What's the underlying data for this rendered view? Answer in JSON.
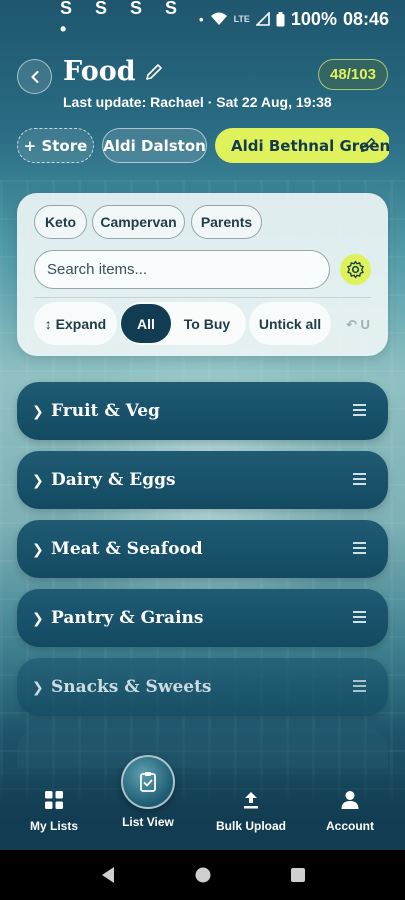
{
  "status_bar": {
    "left_icons": "S S S S •",
    "battery": "100%",
    "time": "08:46",
    "network": "LTE"
  },
  "header": {
    "title": "Food",
    "last_update": "Last update: Rachael · Sat 22 Aug, 19:38",
    "count_badge": "48/103"
  },
  "stores": {
    "add_label": "+ Store",
    "items": [
      "Aldi Dalston",
      "Aldi Bethnal Green"
    ],
    "active": "Aldi Bethnal Green"
  },
  "tags": [
    "Keto",
    "Campervan",
    "Parents"
  ],
  "search": {
    "placeholder": "Search items..."
  },
  "controls": {
    "expand": "↕ Expand",
    "filter_all": "All",
    "filter_to_buy": "To Buy",
    "untick_all": "Untick all",
    "undo": "↶ U"
  },
  "categories": [
    {
      "name": "Fruit & Veg"
    },
    {
      "name": "Dairy & Eggs"
    },
    {
      "name": "Meat & Seafood"
    },
    {
      "name": "Pantry & Grains"
    },
    {
      "name": "Snacks & Sweets"
    }
  ],
  "bottom_nav": {
    "my_lists": "My Lists",
    "list_view": "List View",
    "bulk_upload": "Bulk Upload",
    "account": "Account"
  },
  "colors": {
    "accent_lime": "#dff25b",
    "dark_teal": "#123c52",
    "card_teal": "#1a5670"
  },
  "icons": {
    "back": "chevron-left-icon",
    "edit": "pencil-icon",
    "settings": "gear-icon",
    "drag": "drag-handle-icon",
    "nav_center": "clipboard-icon"
  }
}
